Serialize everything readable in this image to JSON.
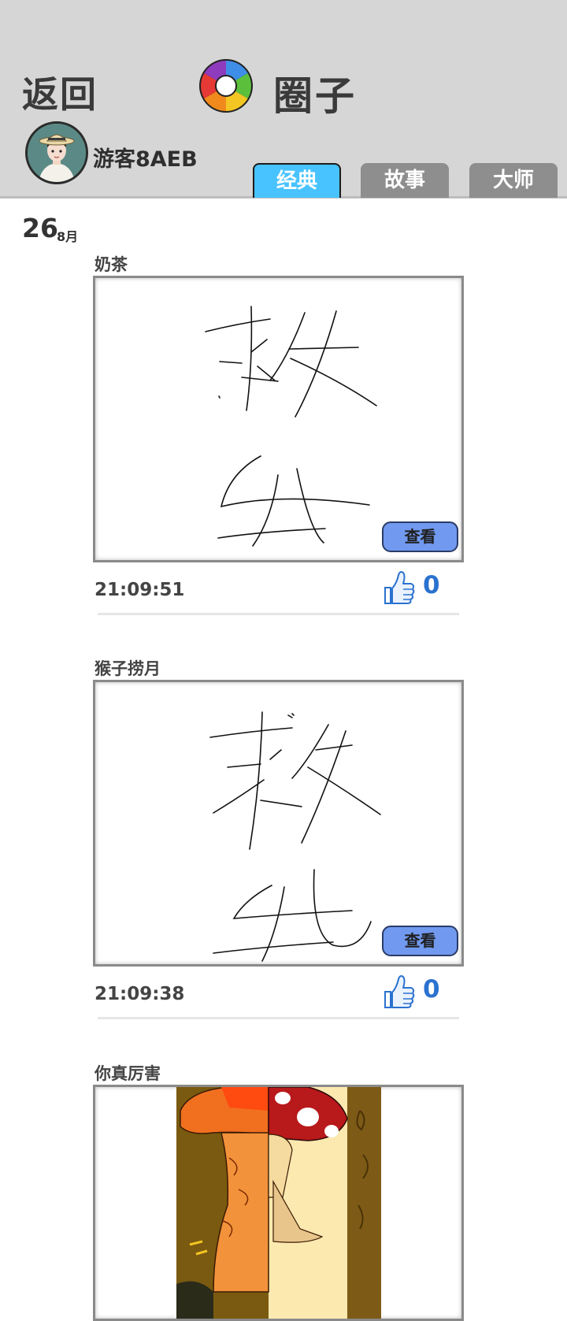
{
  "header": {
    "back_label": "返回",
    "title": "圈子",
    "username": "游客8AEB",
    "tabs": [
      {
        "label": "经典",
        "active": true
      },
      {
        "label": "故事",
        "active": false
      },
      {
        "label": "大师",
        "active": false
      }
    ]
  },
  "date": {
    "day": "26",
    "month": "8月"
  },
  "posts": [
    {
      "title": "奶茶",
      "time": "21:09:51",
      "likes": "0",
      "view_label": "查看"
    },
    {
      "title": "猴子捞月",
      "time": "21:09:38",
      "likes": "0",
      "view_label": "查看"
    },
    {
      "title": "你真厉害"
    }
  ],
  "colors": {
    "header_bg": "#d6d6d6",
    "active_tab": "#48c3ff",
    "inactive_tab": "#8e8e8e",
    "view_button": "#7199ef",
    "like_blue": "#2a72cf"
  },
  "icons": [
    "camera-aperture-logo",
    "avatar",
    "thumbs-up-icon"
  ]
}
